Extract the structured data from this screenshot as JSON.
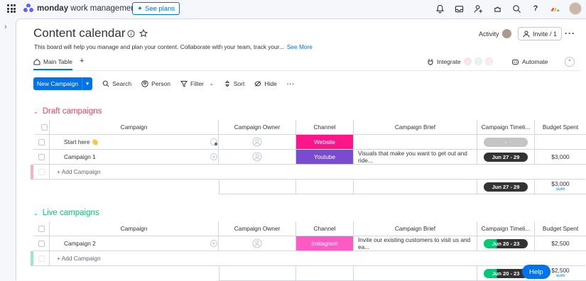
{
  "topbar": {
    "brand_bold": "monday",
    "brand_rest": " work management",
    "see_plans": "See plans",
    "icons": [
      "bell-icon",
      "inbox-icon",
      "invite-members-icon",
      "apps-icon",
      "search-icon",
      "help-icon",
      "monday-apps-icon",
      "avatar"
    ]
  },
  "board": {
    "title": "Content calendar",
    "description": "This board will help you manage and plan your content. Collaborate with your team, track your...",
    "see_more": "See More",
    "activity": "Activity",
    "invite": "Invite / 1",
    "tabs": {
      "main": "Main Table",
      "add": "+"
    },
    "integrate": "Integrate",
    "automate": "Automate"
  },
  "toolbar": {
    "new_item": "New Campaign",
    "search": "Search",
    "person": "Person",
    "filter": "Filter",
    "sort": "Sort",
    "hide": "Hide"
  },
  "columns": {
    "campaign": "Campaign",
    "owner": "Campaign Owner",
    "channel": "Channel",
    "brief": "Campaign Brief",
    "timeline": "Campaign Timeli...",
    "budget": "Budget Spent"
  },
  "groups": [
    {
      "title": "Draft campaigns",
      "color": "#e2445c",
      "rows": [
        {
          "name": "Start here 👋",
          "channel": "Website",
          "channel_color": "#ff158a",
          "brief": "",
          "timeline": "-",
          "timeline_color": "#c4c4c4",
          "budget": ""
        },
        {
          "name": "Campaign 1",
          "channel": "Youtube",
          "channel_color": "#784bd1",
          "brief": "Visuals that make you want to get out and ride...",
          "timeline": "Jun 27 - 29",
          "timeline_color": "#333333",
          "budget": "$3,000"
        }
      ],
      "add_label": "+ Add Campaign",
      "summary_timeline": "Jun 27 - 29",
      "summary_budget": "$3,000",
      "summary_label": "sum"
    },
    {
      "title": "Live campaigns",
      "color": "#00c875",
      "rows": [
        {
          "name": "Campaign 2",
          "channel": "Instagram",
          "channel_color": "#ff5ac4",
          "brief": "Invite our existing customers to visit us and ea...",
          "timeline": "Jun 20 - 23",
          "timeline_color": "#333333",
          "budget": "$2,500"
        }
      ],
      "add_label": "+ Add Campaign",
      "summary_timeline": "Jun 20 - 23",
      "summary_budget": "$2,500",
      "summary_label": "sum"
    }
  ],
  "help": "Help"
}
